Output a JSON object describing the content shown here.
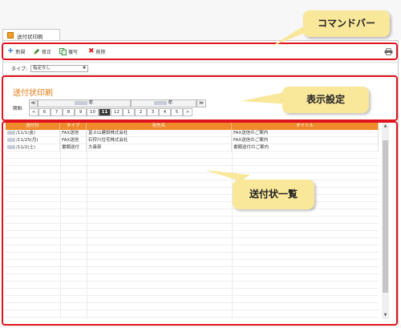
{
  "tab": {
    "title": "送付状印刷",
    "icon": "document-icon"
  },
  "toolbar": {
    "new_label": "新規",
    "edit_label": "修正",
    "copy_label": "複写",
    "delete_label": "削除",
    "print_icon": "printer-icon"
  },
  "filter": {
    "type_label": "タイプ:",
    "type_value": "指定なし"
  },
  "section": {
    "title": "送付状印刷",
    "period_label": "期間:"
  },
  "years": {
    "prev": "≪",
    "left_suffix": "年",
    "right_suffix": "年",
    "next": "≫"
  },
  "months": {
    "prev": "<",
    "list": [
      "6",
      "7",
      "8",
      "9",
      "10",
      "11",
      "12",
      "1",
      "2",
      "3",
      "4",
      "5"
    ],
    "active": "11",
    "next": ">"
  },
  "table": {
    "columns": [
      "送付日",
      "タイプ",
      "宛先名",
      "タイトル"
    ],
    "rows": [
      {
        "date": "/11/1(金)",
        "type": "FAX送信",
        "dest": "富士山建設株式会社",
        "title": "FAX送信のご案内"
      },
      {
        "date": "/11/25(月)",
        "type": "FAX送信",
        "dest": "石狩川住宅株式会社",
        "title": "FAX送信のご案内"
      },
      {
        "date": "/11/2(土)",
        "type": "書類送付",
        "dest": "大衆部",
        "title": "書類送付のご案内"
      }
    ]
  },
  "annotations": {
    "command_bar": "コマンドバー",
    "display_settings": "表示設定",
    "list": "送付状一覧",
    "highlight_color": "#e0141e",
    "callout_color": "#f9e79a"
  },
  "colors": {
    "accent": "#f0892a",
    "title": "#e07a10",
    "active_month": "#3a3a3a"
  }
}
